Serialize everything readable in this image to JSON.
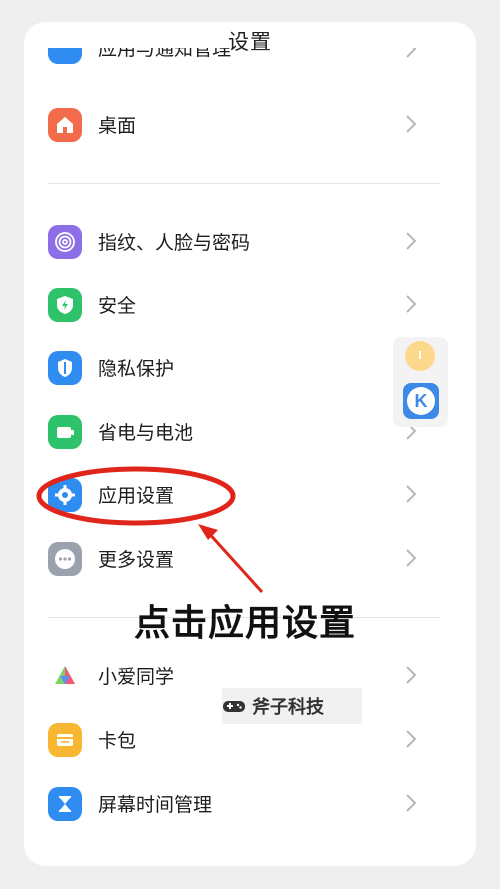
{
  "header": {
    "title": "设置"
  },
  "partial_top_item": {
    "label": "应用与通知管理"
  },
  "settings_group_1": [
    {
      "key": "desktop",
      "label": "桌面",
      "icon": "home-icon",
      "color": "#f26b4a"
    }
  ],
  "settings_group_2": [
    {
      "key": "fingerprint",
      "label": "指纹、人脸与密码",
      "icon": "fingerprint-icon",
      "color": "#8b6ee8"
    },
    {
      "key": "security",
      "label": "安全",
      "icon": "shield-icon",
      "color": "#2ec26a"
    },
    {
      "key": "privacy",
      "label": "隐私保护",
      "icon": "privacy-icon",
      "color": "#2f8cf0"
    },
    {
      "key": "battery",
      "label": "省电与电池",
      "icon": "battery-icon",
      "color": "#2ec26a"
    },
    {
      "key": "apps",
      "label": "应用设置",
      "icon": "gear-icon",
      "color": "#2f8cf0"
    },
    {
      "key": "more",
      "label": "更多设置",
      "icon": "more-icon",
      "color": "#9aa3ad"
    }
  ],
  "settings_group_3": [
    {
      "key": "xiaoai",
      "label": "小爱同学",
      "icon": "xiaoai-icon",
      "color": "#ffffff"
    },
    {
      "key": "wallet",
      "label": "卡包",
      "icon": "wallet-icon",
      "color": "#f7b731"
    },
    {
      "key": "screen_time",
      "label": "屏幕时间管理",
      "icon": "hourglass-icon",
      "color": "#2f8cf0"
    }
  ],
  "annotation": {
    "callout_text": "点击应用设置",
    "highlight_color": "#e0251b"
  },
  "watermark": {
    "text": "斧子科技"
  },
  "floating_dock": {
    "k_letter": "K"
  }
}
